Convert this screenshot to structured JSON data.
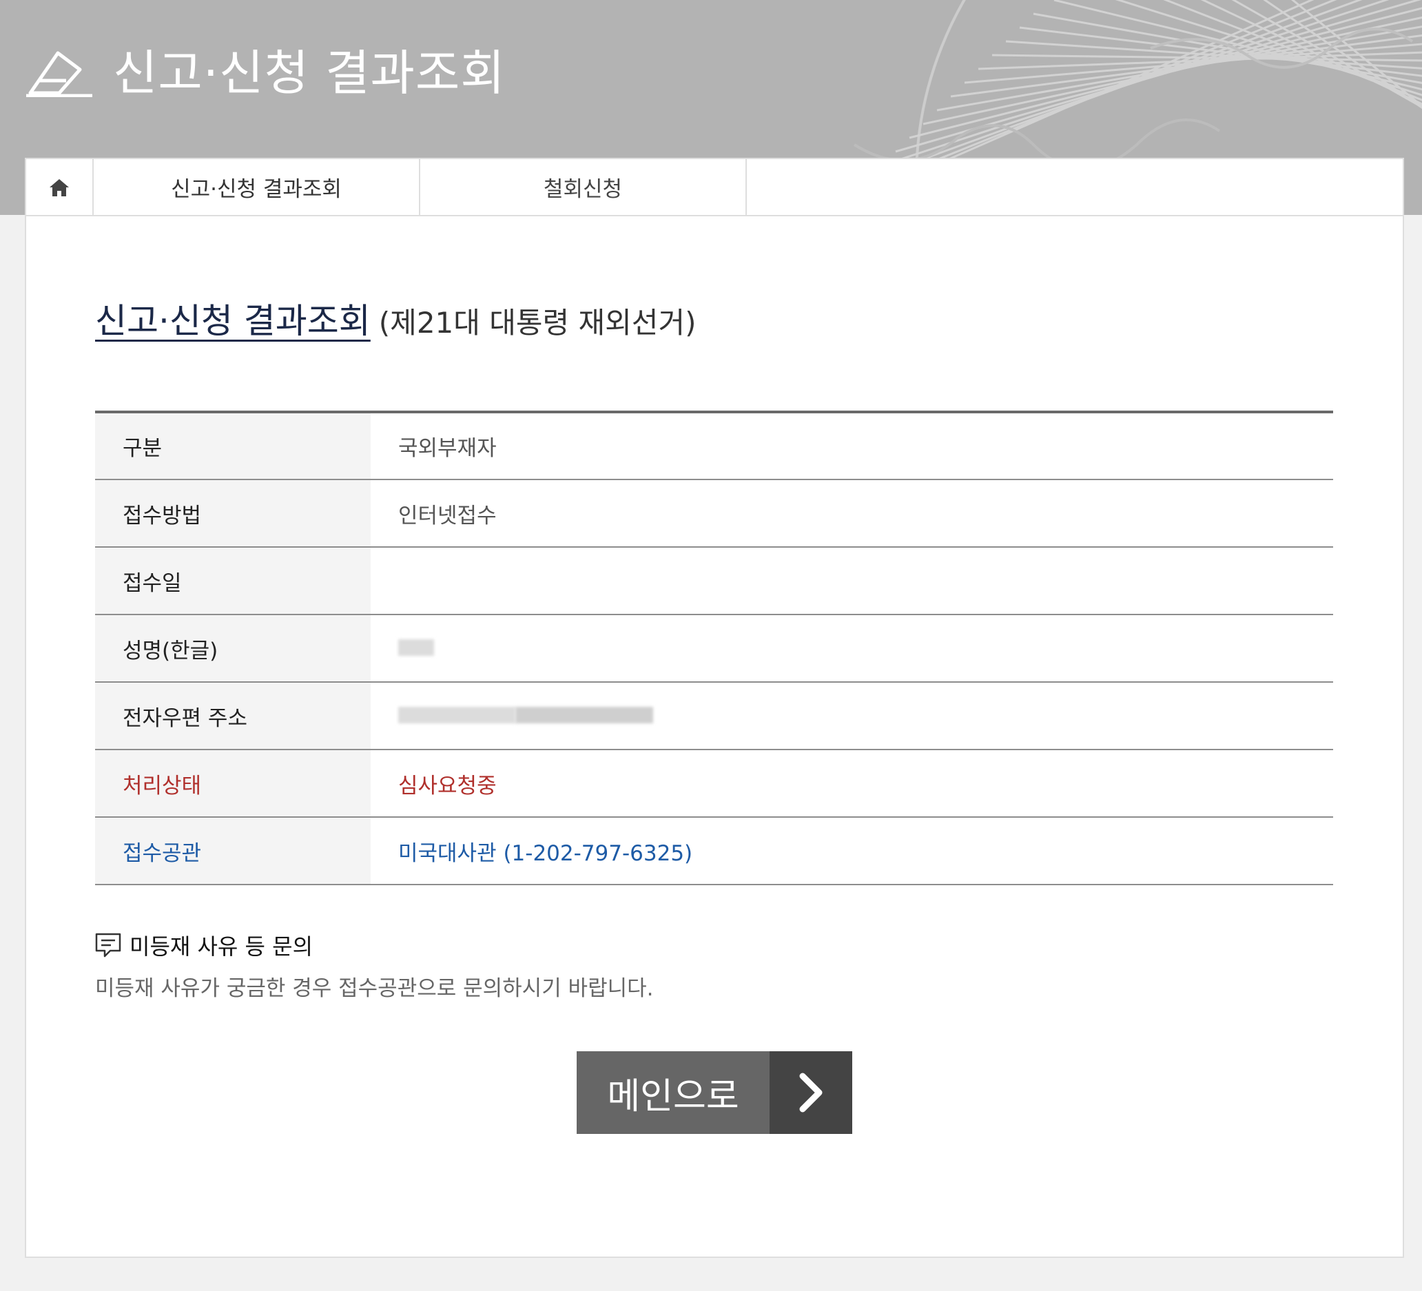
{
  "header": {
    "title": "신고·신청 결과조회"
  },
  "tabs": [
    {
      "label": "신고·신청 결과조회"
    },
    {
      "label": "철회신청"
    }
  ],
  "page": {
    "heading": "신고·신청 결과조회",
    "subheading": "(제21대 대통령 재외선거)"
  },
  "table": {
    "rows": [
      {
        "label": "구분",
        "value": "국외부재자"
      },
      {
        "label": "접수방법",
        "value": "인터넷접수"
      },
      {
        "label": "접수일",
        "value": ""
      },
      {
        "label": "성명(한글)",
        "value": ""
      },
      {
        "label": "전자우편 주소",
        "value": ""
      },
      {
        "label": "처리상태",
        "value": "심사요청중"
      },
      {
        "label": "접수공관",
        "value": "미국대사관 (1-202-797-6325)"
      }
    ]
  },
  "notice": {
    "title": "미등재 사유 등 문의",
    "description": "미등재 사유가 궁금한 경우 접수공관으로 문의하시기 바랍니다."
  },
  "main_button": {
    "label": "메인으로"
  },
  "colors": {
    "header_bg": "#b3b3b3",
    "heading_navy": "#1b2848",
    "status_red": "#b0302c",
    "office_blue": "#1e5ba6",
    "button_gray": "#666666",
    "button_dark": "#444444"
  },
  "icons": {
    "header": "pencil-eraser-icon",
    "home": "home-icon",
    "notice": "chat-bubble-icon",
    "button": "chevron-right-icon"
  }
}
